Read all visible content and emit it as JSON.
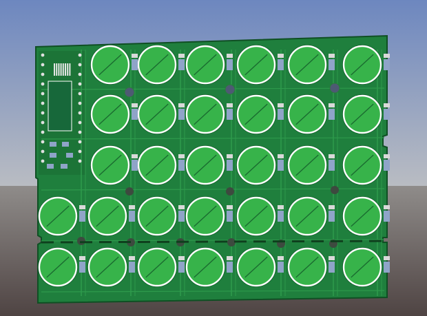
{
  "scene": {
    "description_label": "",
    "colors": {
      "sky_top": "#6d87bf",
      "sky_bottom": "#b9bcc2",
      "ground_top": "#8f8c8a",
      "ground_bottom": "#4f4443",
      "board": "#1f7f3d",
      "board_edge": "#0f4f23",
      "trace": "#2e9a4c",
      "pad_fill": "#37b34a",
      "pad_ring": "#ffffff",
      "smd_pad": "#8fa4c8",
      "via_hole": "#4d5a73",
      "silkscreen": "#ffffff"
    },
    "board": {
      "rows": 5,
      "columns": 7,
      "mounting_holes": 3
    }
  }
}
